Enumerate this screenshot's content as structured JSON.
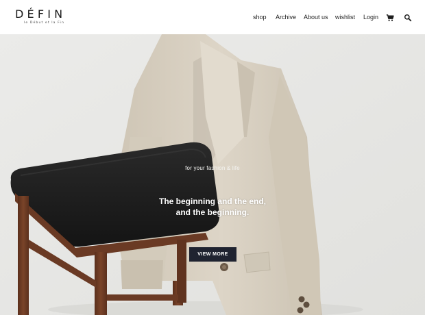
{
  "header": {
    "logo": {
      "name": "DÉFIN",
      "tagline": "le Début et la Fin"
    },
    "nav": [
      {
        "label": "shop"
      },
      {
        "label": "Archive"
      },
      {
        "label": "About us"
      },
      {
        "label": "wishlist"
      },
      {
        "label": "Login"
      }
    ],
    "icons": {
      "cart": "cart-icon",
      "search": "search-icon"
    }
  },
  "hero": {
    "tagline": "for your fashion & life",
    "headline_line1": "The beginning and the end,",
    "headline_line2": "and the beginning.",
    "cta_label": "VIEW MORE",
    "colors": {
      "background": "#e8e8e6",
      "cta": "#1f2330",
      "jacket": "#d8d0c2",
      "seat": "#1d1d1d",
      "wood": "#6a3a24"
    }
  }
}
